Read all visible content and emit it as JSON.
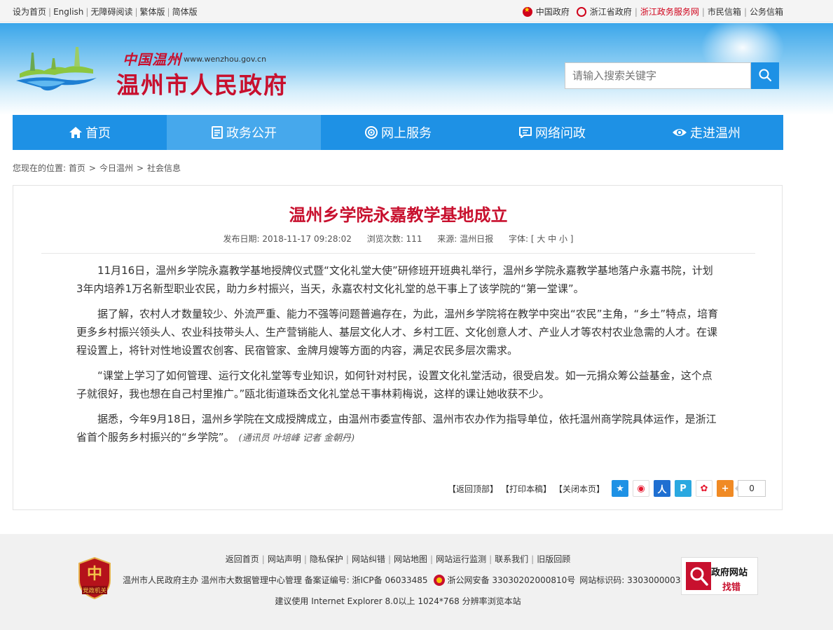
{
  "topbar": {
    "left_links": [
      "设为首页",
      "English",
      "无障碍阅读",
      "繁体版",
      "简体版"
    ],
    "right_links": {
      "china_gov": "中国政府",
      "zj_gov": "浙江省政府",
      "zj_service": "浙江政务服务网",
      "mayor_mail": "市民信箱",
      "official_mail": "公务信箱"
    }
  },
  "header": {
    "logo_cn": "中国温州",
    "logo_url": "www.wenzhou.gov.cn",
    "site_title": "温州市人民政府",
    "search_placeholder": "请输入搜索关键字"
  },
  "nav": [
    "首页",
    "政务公开",
    "网上服务",
    "网络问政",
    "走进温州"
  ],
  "breadcrumb": {
    "prefix": "您现在的位置:",
    "items": [
      "首页",
      "今日温州",
      "社会信息"
    ]
  },
  "article": {
    "title": "温州乡学院永嘉教学基地成立",
    "meta": {
      "date": "发布日期:  2018-11-17 09:28:02",
      "views": "浏览次数:  111",
      "source": "来源:  温州日报",
      "font": "字体: [ 大 中 小 ]"
    },
    "paragraphs": [
      "11月16日，温州乡学院永嘉教学基地授牌仪式暨“文化礼堂大使”研修班开班典礼举行，温州乡学院永嘉教学基地落户永嘉书院，计划3年内培养1万名新型职业农民，助力乡村振兴，当天，永嘉农村文化礼堂的总干事上了该学院的“第一堂课”。",
      "据了解，农村人才数量较少、外流严重、能力不强等问题普遍存在，为此，温州乡学院将在教学中突出“农民”主角，“乡土”特点，培育更多乡村振兴领头人、农业科技带头人、生产营销能人、基层文化人才、乡村工匠、文化创意人才、产业人才等农村农业急需的人才。在课程设置上，将针对性地设置农创客、民宿管家、金牌月嫂等方面的内容，满足农民多层次需求。",
      "“课堂上学习了如何管理、运行文化礼堂等专业知识，如何针对村民，设置文化礼堂活动，很受启发。如一元捐众筹公益基金，这个点子就很好，我也想在自己村里推广。”瓯北街道珠岙文化礼堂总干事林莉梅说，这样的课让她收获不少。",
      "据悉，今年9月18日，温州乡学院在文成授牌成立，由温州市委宣传部、温州市农办作为指导单位，依托温州商学院具体运作，是浙江省首个服务乡村振兴的“乡学院”。"
    ],
    "byline": "(通讯员 叶培峰 记者 金朝丹)",
    "tools": {
      "back_top": "【返回顶部】",
      "print": "【打印本稿】",
      "close": "【关闭本页】",
      "share_count": "0"
    }
  },
  "footer": {
    "links": [
      "返回首页",
      "网站声明",
      "隐私保护",
      "网站纠错",
      "网站地图",
      "网站运行监测",
      "联系我们",
      "旧版回顾"
    ],
    "line2_main": "温州市人民政府主办 温州市大数据管理中心管理 备案证编号: 浙ICP备 06033485",
    "line2_police": "浙公网安备 33030202000810号",
    "line2_code": "网站标识码: 3303000003",
    "line3": "建议使用 Internet Explorer 8.0以上 1024*768 分辨率浏览本站",
    "badge_top": "政府网站",
    "badge_bottom": "找错",
    "party_badge_text": "党政机关"
  },
  "colors": {
    "brand_red": "#c8102e",
    "nav_blue": "#1e91e5",
    "nav_active": "#46a8ec"
  }
}
